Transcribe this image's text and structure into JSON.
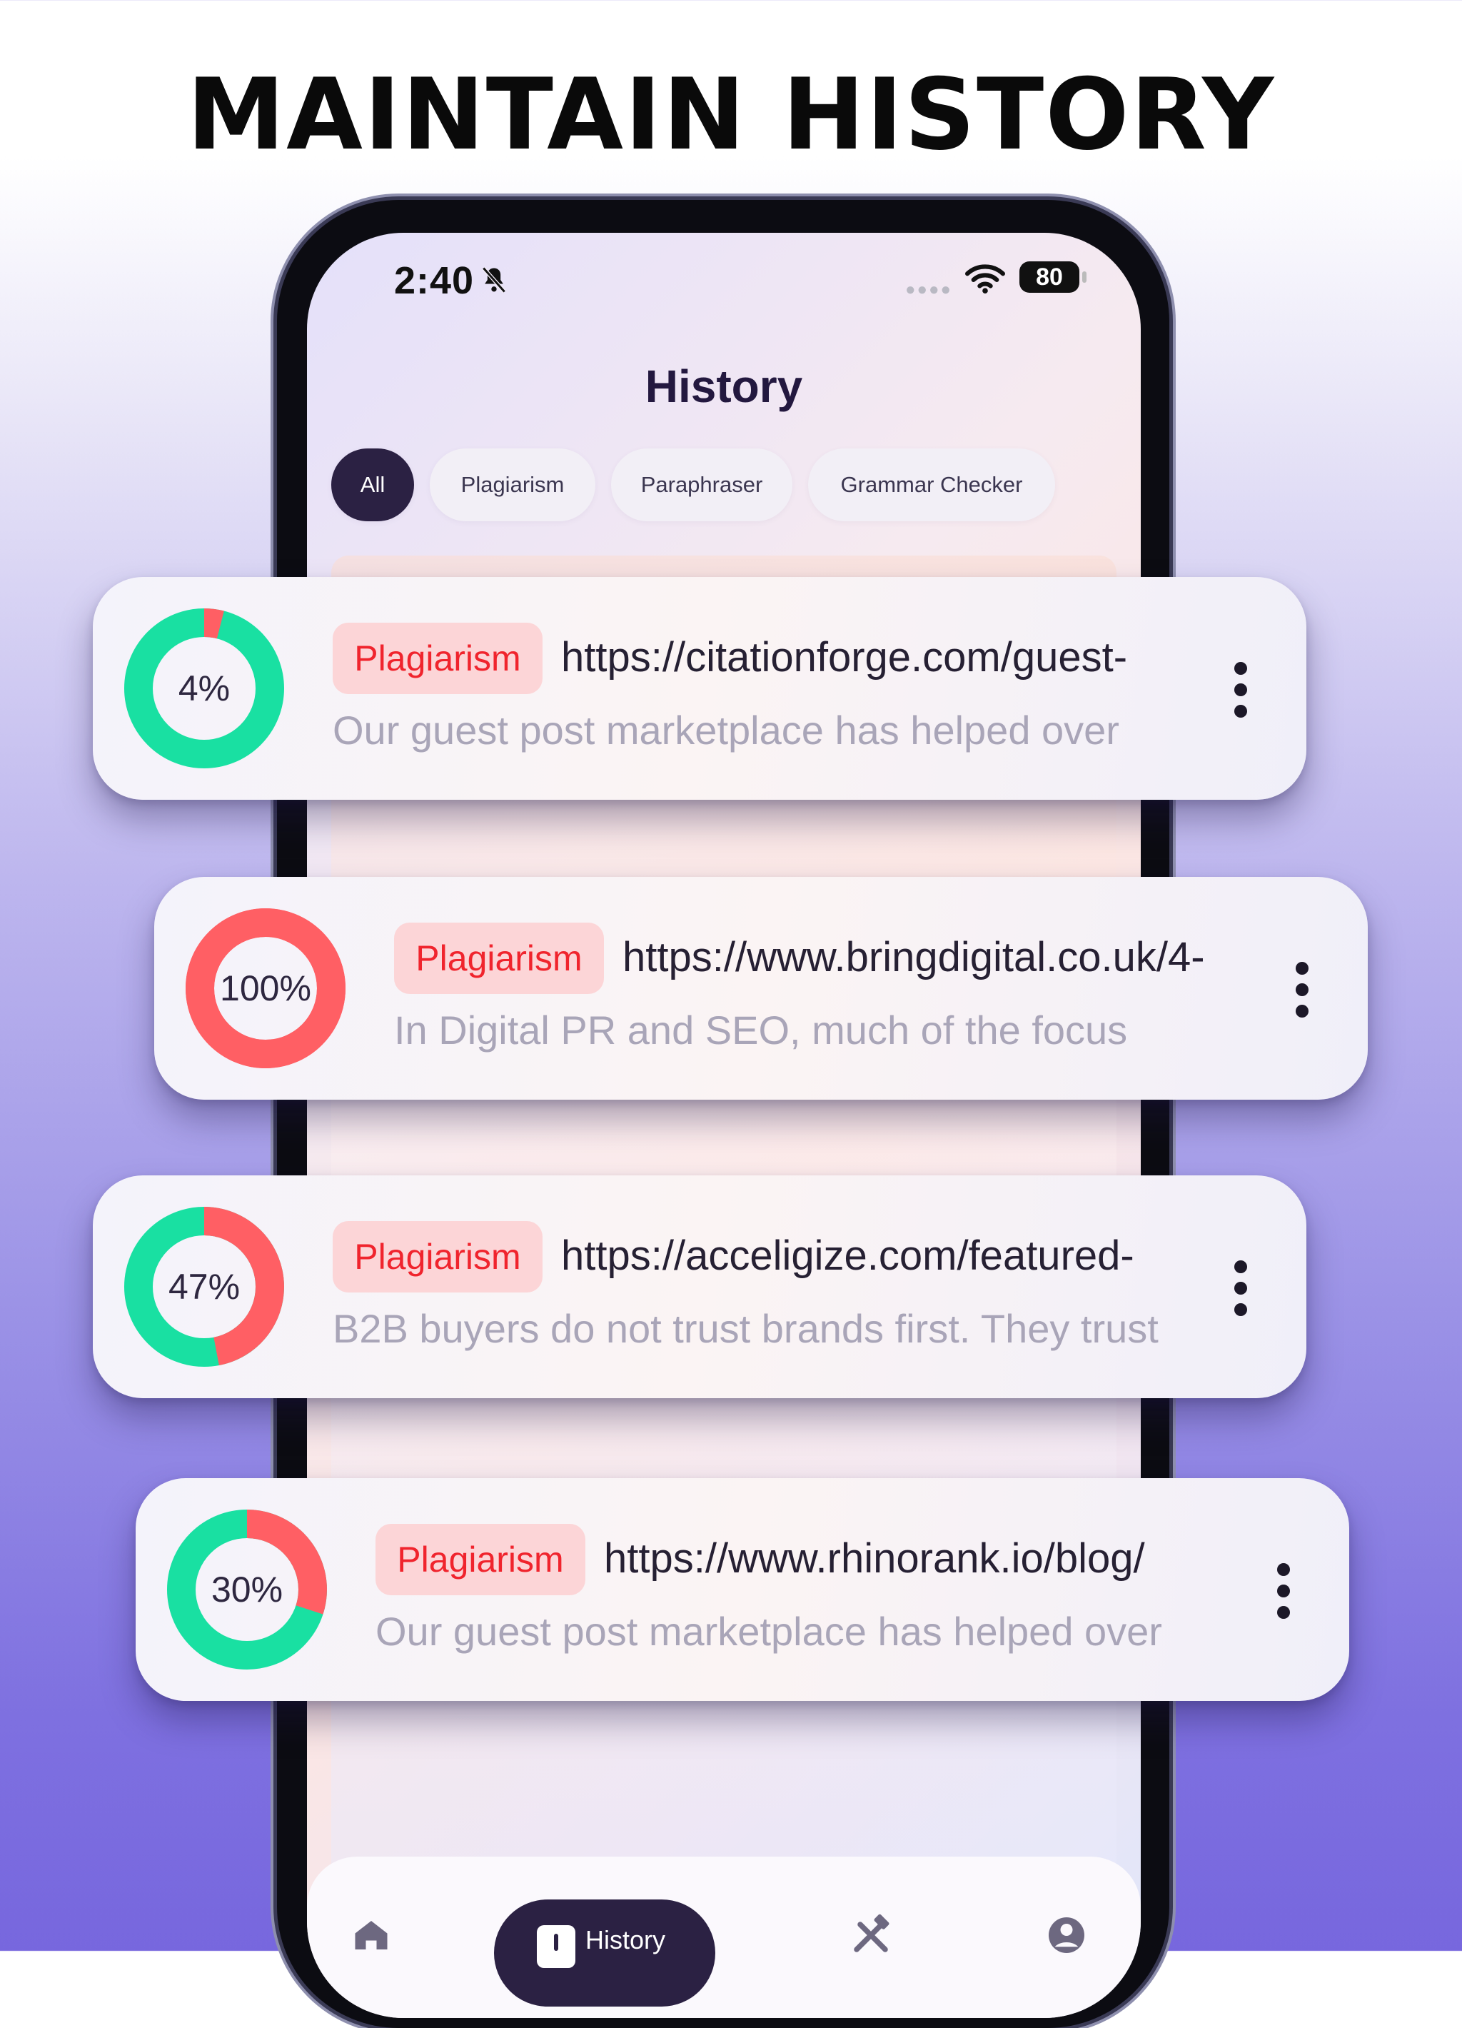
{
  "headline": "MAINTAIN HISTORY",
  "status_bar": {
    "time": "2:40",
    "battery": "80"
  },
  "screen": {
    "title": "History",
    "filters": [
      {
        "label": "All",
        "active": true
      },
      {
        "label": "Plagiarism",
        "active": false
      },
      {
        "label": "Paraphraser",
        "active": false
      },
      {
        "label": "Grammar Checker",
        "active": false
      }
    ]
  },
  "history_items": [
    {
      "percent_label": "4%",
      "score": 4,
      "ring_color": "#19e0a2",
      "tag": "Plagiarism",
      "url": "https://citationforge.com/guest-",
      "snippet": "Our guest post marketplace has helped over"
    },
    {
      "percent_label": "100%",
      "score": 100,
      "ring_color": "#ff5f64",
      "tag": "Plagiarism",
      "url": "https://www.bringdigital.co.uk/4-",
      "snippet": "In Digital PR and SEO, much of the focus"
    },
    {
      "percent_label": "47%",
      "score": 47,
      "ring_color": "#19e0a2",
      "tag": "Plagiarism",
      "url": "https://acceligize.com/featured-",
      "snippet": "B2B buyers do not trust brands first. They trust"
    },
    {
      "percent_label": "30%",
      "score": 30,
      "ring_color": "#19e0a2",
      "tag": "Plagiarism",
      "url": "https://www.rhinorank.io/blog/",
      "snippet": "Our guest post marketplace has helped over"
    }
  ],
  "colors": {
    "ok": "#19e0a2",
    "plagiarized": "#ff5f64",
    "tag_text": "#f0242d",
    "tag_bg": "#fcd5d7",
    "dark": "#2b2143"
  },
  "bottom_nav": {
    "active_label": "History",
    "icons": [
      "home-icon",
      "history-icon",
      "tools-icon",
      "profile-icon"
    ]
  }
}
